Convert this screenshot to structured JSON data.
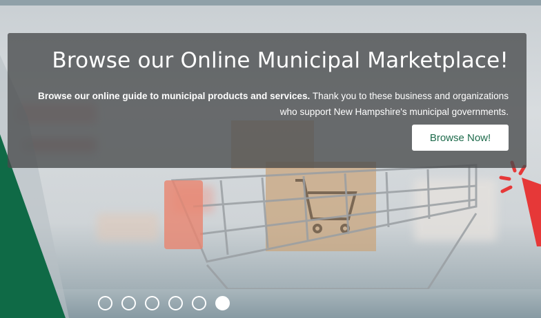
{
  "hero": {
    "title": "Browse our Online Municipal Marketplace!",
    "desc_bold": "Browse our online guide to municipal products and services.",
    "desc_rest": " Thank you to these business and organizations who support New Hampshire's municipal governments.",
    "button_label": "Browse Now!"
  },
  "carousel": {
    "slide_count": 6,
    "active_index": 5
  },
  "colors": {
    "brand_green": "#1e6b4c",
    "accent_red": "#e63838"
  },
  "icons": [
    "shopping-cart-icon",
    "click-pointer-icon"
  ]
}
